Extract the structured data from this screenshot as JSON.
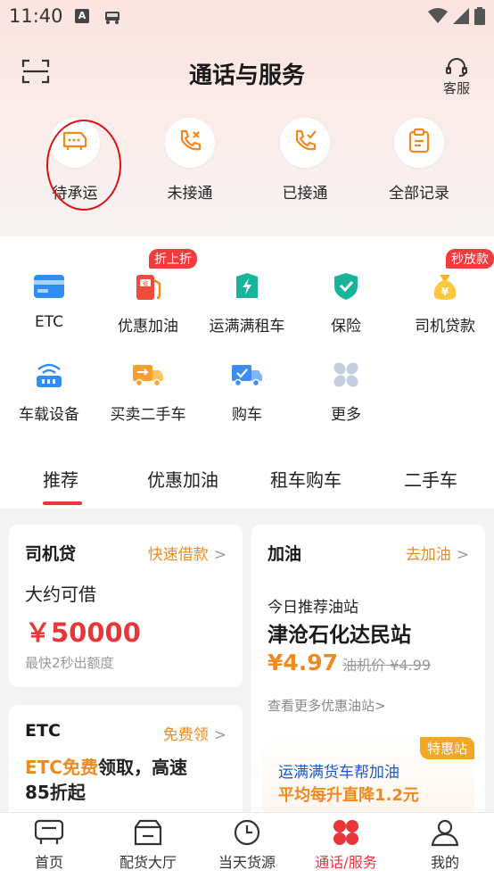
{
  "status_bar": {
    "time": "11:40",
    "a_icon": "A"
  },
  "header": {
    "title": "通话与服务",
    "service_label": "客服"
  },
  "call_items": [
    {
      "label": "待承运",
      "icon": "truck-chat-icon"
    },
    {
      "label": "未接通",
      "icon": "phone-missed-icon"
    },
    {
      "label": "已接通",
      "icon": "phone-check-icon"
    },
    {
      "label": "全部记录",
      "icon": "clipboard-icon"
    }
  ],
  "services": [
    {
      "label": "ETC",
      "icon": "etc-card-icon"
    },
    {
      "label": "优惠加油",
      "icon": "fuel-icon",
      "badge": "折上折"
    },
    {
      "label": "运满满租车",
      "icon": "rental-icon"
    },
    {
      "label": "保险",
      "icon": "shield-icon"
    },
    {
      "label": "司机贷款",
      "icon": "money-bag-icon",
      "badge": "秒放款"
    },
    {
      "label": "车载设备",
      "icon": "device-icon"
    },
    {
      "label": "买卖二手车",
      "icon": "used-truck-icon"
    },
    {
      "label": "购车",
      "icon": "buy-truck-icon"
    },
    {
      "label": "更多",
      "icon": "more-icon"
    }
  ],
  "tabs": [
    "推荐",
    "优惠加油",
    "租车购车",
    "二手车"
  ],
  "loan_card": {
    "title": "司机贷",
    "link": "快速借款",
    "subtitle": "大约可借",
    "amount": "￥50000",
    "note": "最快2秒出额度"
  },
  "fuel_card": {
    "title": "加油",
    "link": "去加油",
    "subtitle": "今日推荐油站",
    "station": "津沧石化达民站",
    "price": "¥4.97",
    "old_price": "油机价 ¥4.99",
    "more": "查看更多优惠油站>"
  },
  "etc_card": {
    "title": "ETC",
    "link": "免费领",
    "line1_highlight": "ETC免费",
    "line1_rest": "领取，高速",
    "line2": "85折起"
  },
  "promo": {
    "badge": "特惠站",
    "line1": "运满满货车帮加油",
    "line2": "平均每升直降1.2元"
  },
  "bottom_nav": [
    {
      "label": "首页",
      "icon": "home-truck-icon"
    },
    {
      "label": "配货大厅",
      "icon": "box-icon"
    },
    {
      "label": "当天货源",
      "icon": "clock-icon"
    },
    {
      "label": "通话/服务",
      "icon": "service-petals-icon",
      "active": true
    },
    {
      "label": "我的",
      "icon": "person-icon"
    }
  ],
  "colors": {
    "accent": "#e8363a",
    "orange": "#f08a1e",
    "teal": "#17b39b",
    "blue": "#2f8ef0"
  }
}
